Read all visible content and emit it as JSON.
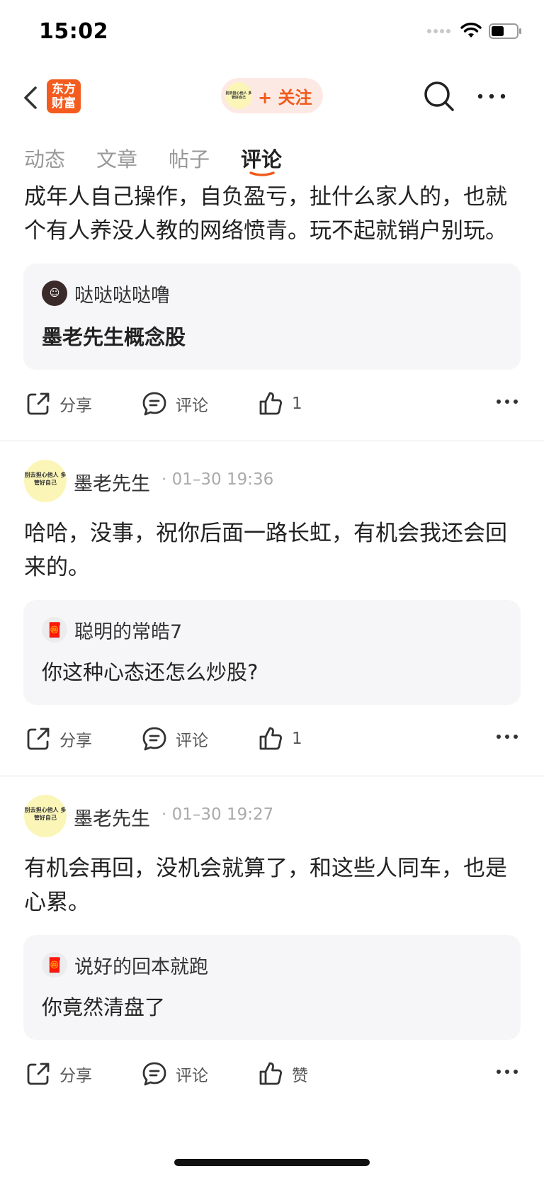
{
  "status_bar": {
    "time": "15:02"
  },
  "nav": {
    "logo_line1": "东方",
    "logo_line2": "财富",
    "pill_avatar_text": "别去担心他人 多管好自己",
    "follow_label": "+ 关注"
  },
  "tabs": [
    {
      "label": "动态"
    },
    {
      "label": "文章"
    },
    {
      "label": "帖子"
    },
    {
      "label": "评论"
    }
  ],
  "posts": [
    {
      "text": "成年人自己操作，自负盈亏，扯什么家人的，也就个有人养没人教的网络愤青。玩不起就销户别玩。",
      "quote_user": "哒哒哒哒噜",
      "quote_text": "墨老先生概念股",
      "share_label": "分享",
      "comment_label": "评论",
      "like_label": "1"
    },
    {
      "avatar_text": "别去担心他人 多管好自己",
      "author": "墨老先生",
      "time": "· 01–30 19:36",
      "text": "哈哈，没事，祝你后面一路长虹，有机会我还会回来的。",
      "quote_user": "聪明的常皓7",
      "quote_text": "你这种心态还怎么炒股?",
      "share_label": "分享",
      "comment_label": "评论",
      "like_label": "1"
    },
    {
      "avatar_text": "别去担心他人 多管好自己",
      "author": "墨老先生",
      "time": "· 01–30 19:27",
      "text": "有机会再回，没机会就算了，和这些人同车，也是心累。",
      "quote_user": "说好的回本就跑",
      "quote_text": "你竟然清盘了",
      "share_label": "分享",
      "comment_label": "评论",
      "like_label": "赞"
    }
  ],
  "colors": {
    "accent": "#f05a1d",
    "quote_bg": "#f6f6f8"
  }
}
